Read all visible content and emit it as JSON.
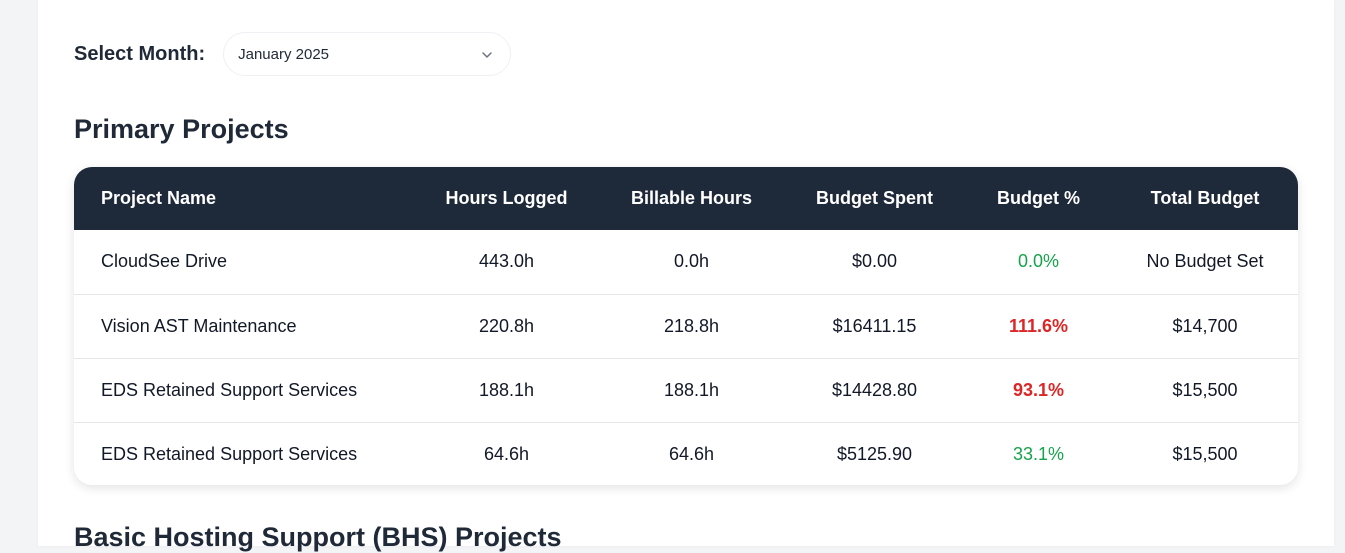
{
  "month_selector": {
    "label": "Select Month:",
    "selected": "January 2025"
  },
  "primary_projects": {
    "title": "Primary Projects",
    "columns": [
      "Project Name",
      "Hours Logged",
      "Billable Hours",
      "Budget Spent",
      "Budget %",
      "Total Budget"
    ],
    "rows": [
      {
        "name": "CloudSee Drive",
        "hours": "443.0h",
        "billable": "0.0h",
        "spent": "$0.00",
        "pct": "0.0%",
        "pct_status": "ok",
        "total": "No Budget Set"
      },
      {
        "name": "Vision AST Maintenance",
        "hours": "220.8h",
        "billable": "218.8h",
        "spent": "$16411.15",
        "pct": "111.6%",
        "pct_status": "over",
        "total": "$14,700"
      },
      {
        "name": "EDS Retained Support Services",
        "hours": "188.1h",
        "billable": "188.1h",
        "spent": "$14428.80",
        "pct": "93.1%",
        "pct_status": "over",
        "total": "$15,500"
      },
      {
        "name": "EDS Retained Support Services",
        "hours": "64.6h",
        "billable": "64.6h",
        "spent": "$5125.90",
        "pct": "33.1%",
        "pct_status": "ok",
        "total": "$15,500"
      }
    ]
  },
  "bhs_projects": {
    "title": "Basic Hosting Support (BHS) Projects"
  },
  "colors": {
    "header_bg": "#1e2939",
    "pct_ok": "#16a34a",
    "pct_over": "#dc2626"
  },
  "icons": {
    "dropdown": "chevron-down-icon"
  }
}
